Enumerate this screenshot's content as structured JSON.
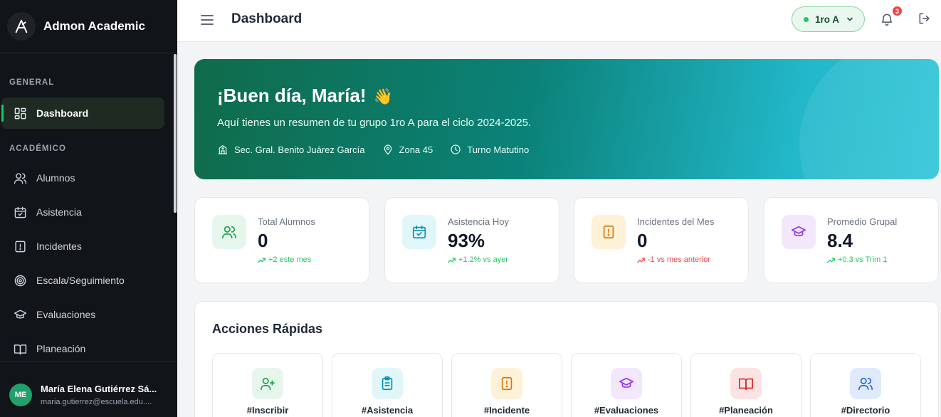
{
  "app": {
    "name": "Admon Academic"
  },
  "sidebar": {
    "sections": [
      {
        "label": "GENERAL"
      },
      {
        "label": "ACADÉMICO"
      }
    ],
    "items": [
      {
        "label": "Dashboard",
        "icon": "dashboard-grid-icon",
        "active": true
      },
      {
        "label": "Alumnos",
        "icon": "users-icon"
      },
      {
        "label": "Asistencia",
        "icon": "calendar-check-icon"
      },
      {
        "label": "Incidentes",
        "icon": "alert-file-icon"
      },
      {
        "label": "Escala/Seguimiento",
        "icon": "target-icon"
      },
      {
        "label": "Evaluaciones",
        "icon": "graduation-cap-icon"
      },
      {
        "label": "Planeación",
        "icon": "book-open-icon"
      }
    ],
    "user": {
      "initials": "ME",
      "name": "María Elena Gutiérrez Sá...",
      "email": "maria.gutierrez@escuela.edu...."
    }
  },
  "header": {
    "title": "Dashboard",
    "group_selector": "1ro A",
    "notifications_count": "3"
  },
  "hero": {
    "greeting": "¡Buen día, María!",
    "wave": "👋",
    "subtitle": "Aquí tienes un resumen de tu grupo 1ro A para el ciclo 2024-2025.",
    "school": "Sec. Gral. Benito Juárez García",
    "zone": "Zona 45",
    "shift": "Turno Matutino"
  },
  "stats": [
    {
      "label": "Total Alumnos",
      "value": "0",
      "trend": "+2 este mes",
      "trend_dir": "up",
      "color": "#16a34a",
      "bg": "#e7f6ec",
      "icon": "users-icon"
    },
    {
      "label": "Asistencia Hoy",
      "value": "93%",
      "trend": "+1.2% vs ayer",
      "trend_dir": "up",
      "color": "#0891b2",
      "bg": "#e0f6f9",
      "icon": "calendar-check-icon"
    },
    {
      "label": "Incidentes del Mes",
      "value": "0",
      "trend": "-1 vs mes anterior",
      "trend_dir": "down",
      "color": "#d97706",
      "bg": "#fdf1d8",
      "icon": "alert-file-icon"
    },
    {
      "label": "Promedio Grupal",
      "value": "8.4",
      "trend": "+0.3 vs Trim 1",
      "trend_dir": "up",
      "color": "#9333ea",
      "bg": "#f3e8fb",
      "icon": "graduation-cap-icon"
    }
  ],
  "quick_actions": {
    "title": "Acciones Rápidas",
    "items": [
      {
        "label": "#Inscribir",
        "icon": "user-plus-icon",
        "color": "#16a34a",
        "bg": "#e7f6ec"
      },
      {
        "label": "#Asistencia",
        "icon": "clipboard-icon",
        "color": "#0891b2",
        "bg": "#e0f6f9"
      },
      {
        "label": "#Incidente",
        "icon": "alert-file-icon",
        "color": "#d97706",
        "bg": "#fdf1d8"
      },
      {
        "label": "#Evaluaciones",
        "icon": "graduation-cap-icon",
        "color": "#9333ea",
        "bg": "#f3e8fb"
      },
      {
        "label": "#Planeación",
        "icon": "book-open-icon",
        "color": "#dc2626",
        "bg": "#fbe3e3"
      },
      {
        "label": "#Directorio",
        "icon": "users-icon",
        "color": "#2563eb",
        "bg": "#dfeafd"
      }
    ]
  },
  "colors": {
    "accent": "#22c55e",
    "sidebar_bg": "#111418",
    "trend_up": "#22c55e",
    "trend_down": "#ef4444"
  }
}
